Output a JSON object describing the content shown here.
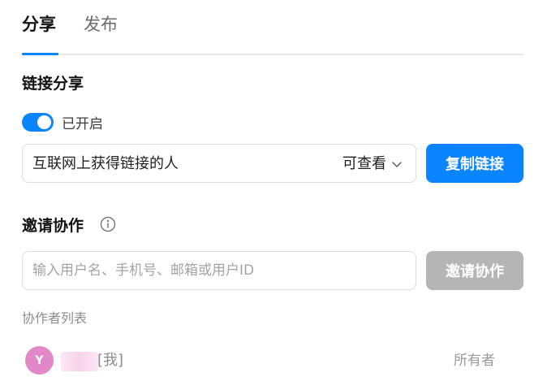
{
  "tabs": [
    {
      "label": "分享",
      "active": true
    },
    {
      "label": "发布",
      "active": false
    }
  ],
  "link_share": {
    "title": "链接分享",
    "toggle_label": "已开启",
    "toggle_on": true,
    "scope": "互联网上获得链接的人",
    "permission": "可查看",
    "copy_button": "复制链接"
  },
  "invite": {
    "title": "邀请协作",
    "input_placeholder": "输入用户名、手机号、邮箱或用户ID",
    "input_value": "",
    "button": "邀请协作"
  },
  "collaborators": {
    "label": "协作者列表",
    "items": [
      {
        "avatar_letter": "Y",
        "me_tag": "[我]",
        "role": "所有者"
      }
    ]
  },
  "colors": {
    "accent": "#0a84ff",
    "disabled": "#b5b5b5",
    "avatar": "#e288c9"
  }
}
